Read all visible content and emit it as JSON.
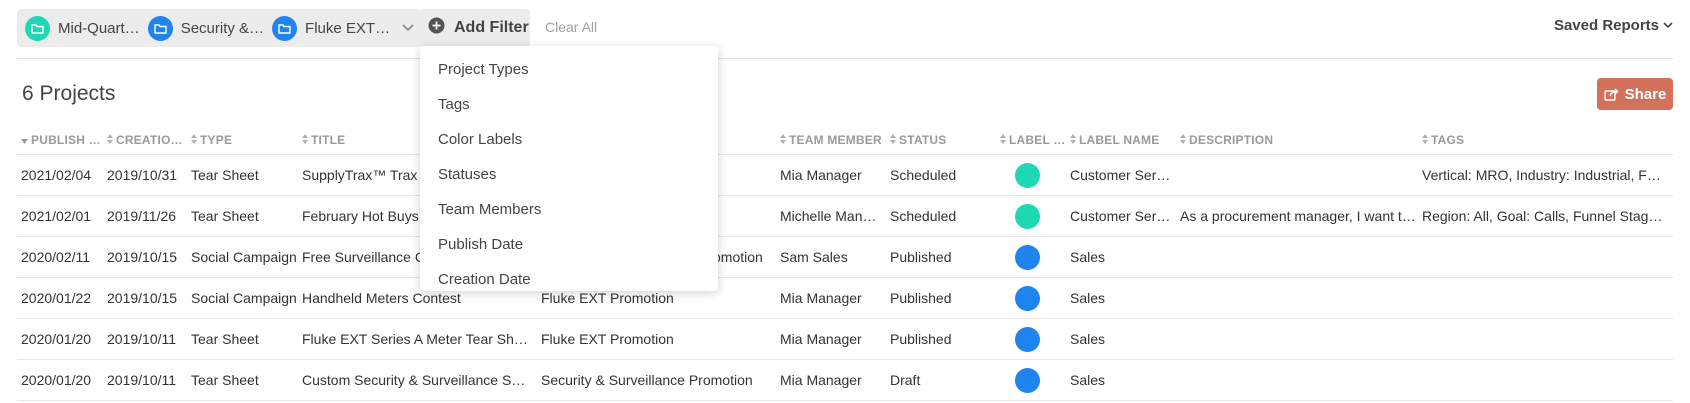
{
  "filters": {
    "chips": [
      {
        "label": "Mid-Quart…",
        "color": "#1ed8b4"
      },
      {
        "label": "Security &…",
        "color": "#1f83f0"
      },
      {
        "label": "Fluke EXT…",
        "color": "#1f83f0"
      }
    ],
    "add_filter_label": "Add Filter",
    "clear_all_label": "Clear All"
  },
  "saved_reports_label": "Saved Reports",
  "page_title": "6 Projects",
  "share_label": "Share",
  "colors": {
    "accent_share": "#d2715c",
    "teal": "#1ed8b4",
    "blue": "#1f83f0"
  },
  "table": {
    "headers": {
      "publish": "PUBLISH …",
      "creation": "CREATIO…",
      "type": "TYPE",
      "title": "TITLE",
      "team_member": "TEAM MEMBER",
      "status": "STATUS",
      "label": "LABEL …",
      "label_name": "LABEL NAME",
      "description": "DESCRIPTION",
      "tags": "TAGS"
    },
    "rows": [
      {
        "publish": "2021/02/04",
        "creation": "2019/10/31",
        "type": "Tear Sheet",
        "title": "SupplyTrax™ Trax C",
        "campaign": "",
        "team_member": "Mia Manager",
        "status": "Scheduled",
        "label_color": "#1ed8b4",
        "label_name": "Customer Serv…",
        "description": "",
        "tags": "Vertical: MRO, Industry: Industrial, Fu…"
      },
      {
        "publish": "2021/02/01",
        "creation": "2019/11/26",
        "type": "Tear Sheet",
        "title": "February Hot Buys",
        "campaign": "",
        "team_member": "Michelle Mana…",
        "status": "Scheduled",
        "label_color": "#1ed8b4",
        "label_name": "Customer Serv…",
        "description": "As a procurement manager, I want to…",
        "tags": "Region: All, Goal: Calls, Funnel Stage…"
      },
      {
        "publish": "2020/02/11",
        "creation": "2019/10/15",
        "type": "Social Campaign",
        "title": "Free Surveillance Ca",
        "campaign": "Promotion",
        "team_member": "Sam Sales",
        "status": "Published",
        "label_color": "#1f83f0",
        "label_name": "Sales",
        "description": "",
        "tags": ""
      },
      {
        "publish": "2020/01/22",
        "creation": "2019/10/15",
        "type": "Social Campaign",
        "title": "Handheld Meters Contest",
        "campaign": "Fluke EXT Promotion",
        "team_member": "Mia Manager",
        "status": "Published",
        "label_color": "#1f83f0",
        "label_name": "Sales",
        "description": "",
        "tags": ""
      },
      {
        "publish": "2020/01/20",
        "creation": "2019/10/11",
        "type": "Tear Sheet",
        "title": "Fluke EXT Series A Meter Tear Sheet",
        "campaign": "Fluke EXT Promotion",
        "team_member": "Mia Manager",
        "status": "Published",
        "label_color": "#1f83f0",
        "label_name": "Sales",
        "description": "",
        "tags": ""
      },
      {
        "publish": "2020/01/20",
        "creation": "2019/10/11",
        "type": "Tear Sheet",
        "title": "Custom Security & Surveillance Servi…",
        "campaign": "Security & Surveillance Promotion",
        "team_member": "Mia Manager",
        "status": "Draft",
        "label_color": "#1f83f0",
        "label_name": "Sales",
        "description": "",
        "tags": ""
      }
    ]
  },
  "dropdown": {
    "items": [
      "Project Types",
      "Tags",
      "Color Labels",
      "Statuses",
      "Team Members",
      "Publish Date",
      "Creation Date"
    ]
  }
}
